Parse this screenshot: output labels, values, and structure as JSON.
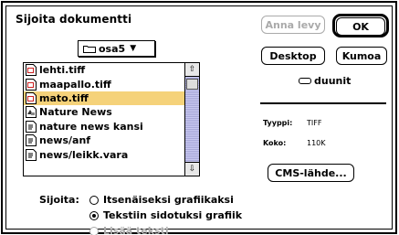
{
  "dialog": {
    "title": "Sijoita dokumentti"
  },
  "folder_popup": {
    "label": "osa5",
    "arrow": "▼"
  },
  "file_list": {
    "items": [
      {
        "name": "lehti.tiff",
        "icon": "tiff-document-icon",
        "selected": false
      },
      {
        "name": "maapallo.tiff",
        "icon": "tiff-document-icon",
        "selected": false
      },
      {
        "name": "mato.tiff",
        "icon": "tiff-document-icon",
        "selected": true
      },
      {
        "name": "Nature News",
        "icon": "pagemaker-document-icon",
        "selected": false
      },
      {
        "name": "nature news kansi",
        "icon": "text-document-icon",
        "selected": false
      },
      {
        "name": "news/anf",
        "icon": "text-document-icon",
        "selected": false
      },
      {
        "name": "news/leikk.vara",
        "icon": "text-document-icon",
        "selected": false
      }
    ],
    "scroll_up": "⇧",
    "scroll_down": "⇩"
  },
  "buttons": {
    "eject_label": "Anna levy",
    "ok_label": "OK",
    "desktop_label": "Desktop",
    "cancel_label": "Kumoa",
    "cms_label": "CMS-lähde..."
  },
  "volume": {
    "name": "duunit"
  },
  "info": {
    "type_label": "Tyyppi:",
    "type_value": "TIFF",
    "size_label": "Koko:",
    "size_value": "110K"
  },
  "placement": {
    "label": "Sijoita:",
    "options": [
      {
        "label": "Itsenäiseksi grafiikaksi",
        "selected": false,
        "enabled": true
      },
      {
        "label": "Tekstiin sidotuksi grafiik",
        "selected": true,
        "enabled": true
      },
      {
        "label": "Lisää teksti",
        "selected": false,
        "enabled": false
      }
    ]
  }
}
